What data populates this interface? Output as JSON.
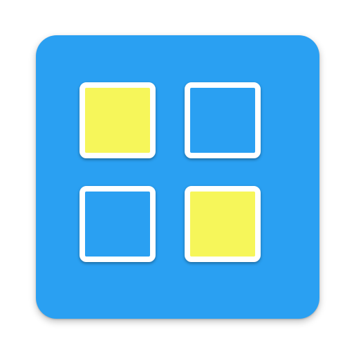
{
  "icon": {
    "name": "grid-tiles-icon",
    "background_color": "#2aa0f2",
    "tiles": [
      {
        "id": "tile-top-left",
        "fill_color": "#f6f65a"
      },
      {
        "id": "tile-top-right",
        "fill_color": "#2aa0f2"
      },
      {
        "id": "tile-bottom-left",
        "fill_color": "#2aa0f2"
      },
      {
        "id": "tile-bottom-right",
        "fill_color": "#f6f65a"
      }
    ]
  }
}
